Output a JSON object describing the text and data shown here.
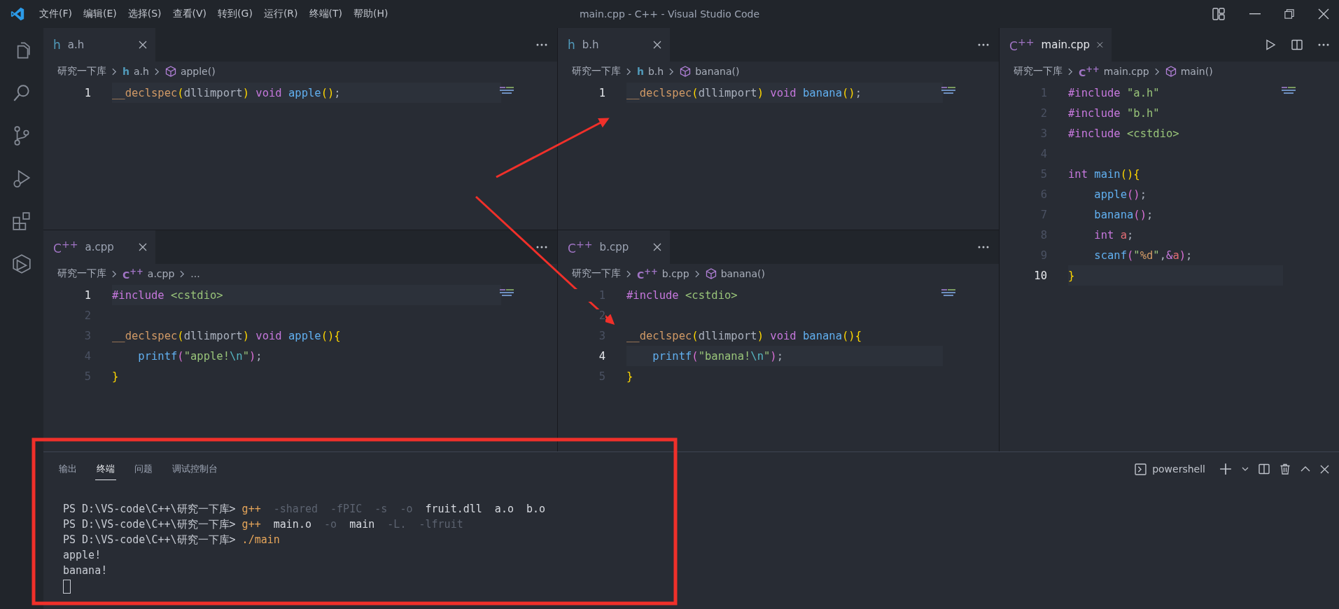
{
  "window": {
    "menus": [
      "文件(F)",
      "编辑(E)",
      "选择(S)",
      "查看(V)",
      "转到(G)",
      "运行(R)",
      "终端(T)",
      "帮助(H)"
    ],
    "title": "main.cpp - C++ - Visual Studio Code"
  },
  "editor_columns": [
    {
      "groups": [
        {
          "tab": {
            "label": "a.h",
            "icon": {
              "text": "h",
              "kind": "header"
            },
            "focused": false
          },
          "breadcrumbs": {
            "folder": "研究一下库",
            "file_icon": {
              "text": "h",
              "kind": "header"
            },
            "file": "a.h",
            "symbol": "apple()"
          },
          "lines": [
            {
              "number": "1",
              "current": true,
              "tokens": [
                {
                  "kind": "mac",
                  "text": "__declspec"
                },
                {
                  "kind": "b1",
                  "text": "("
                },
                {
                  "kind": "plain",
                  "text": "dllimport"
                },
                {
                  "kind": "b1",
                  "text": ")"
                },
                {
                  "kind": "kw",
                  "text": " void"
                },
                {
                  "kind": "fn",
                  "text": " apple"
                },
                {
                  "kind": "b1",
                  "text": "()"
                },
                {
                  "kind": "plain",
                  "text": ";"
                }
              ]
            }
          ]
        },
        {
          "tab": {
            "label": "a.cpp",
            "icon": {
              "text": "C$^{++}$",
              "kind": "cpp"
            },
            "focused": false
          },
          "breadcrumbs": {
            "folder": "研究一下库",
            "file_icon": {
              "text": "C$^{++}$",
              "kind": "cpp"
            },
            "file": "a.cpp",
            "more": "..."
          },
          "lines": [
            {
              "number": "1",
              "current": true,
              "tokens": [
                {
                  "kind": "kw",
                  "text": "#include"
                },
                {
                  "kind": "str",
                  "text": " <cstdio>"
                }
              ]
            },
            {
              "number": "2",
              "current": false
            },
            {
              "number": "3",
              "current": false,
              "tokens": [
                {
                  "kind": "mac",
                  "text": "__declspec"
                },
                {
                  "kind": "b1",
                  "text": "("
                },
                {
                  "kind": "plain",
                  "text": "dllimport"
                },
                {
                  "kind": "b1",
                  "text": ")"
                },
                {
                  "kind": "kw",
                  "text": " void"
                },
                {
                  "kind": "fn",
                  "text": " apple"
                },
                {
                  "kind": "b1",
                  "text": "(){"
                }
              ]
            },
            {
              "number": "4",
              "current": false,
              "indented": true,
              "tokens": [
                {
                  "kind": "fn",
                  "text": "printf"
                },
                {
                  "kind": "b2",
                  "text": "("
                },
                {
                  "kind": "str",
                  "text": "\"apple!"
                },
                {
                  "kind": "esc",
                  "text": "\\n"
                },
                {
                  "kind": "str",
                  "text": "\""
                },
                {
                  "kind": "b2",
                  "text": ")"
                },
                {
                  "kind": "plain",
                  "text": ";"
                }
              ]
            },
            {
              "number": "5",
              "current": false,
              "tokens": [
                {
                  "kind": "b1",
                  "text": "}"
                }
              ]
            }
          ]
        }
      ]
    },
    {
      "groups": [
        {
          "tab": {
            "label": "b.h",
            "icon": {
              "text": "h",
              "kind": "header"
            },
            "focused": false
          },
          "breadcrumbs": {
            "folder": "研究一下库",
            "file_icon": {
              "text": "h",
              "kind": "header"
            },
            "file": "b.h",
            "symbol": "banana()"
          },
          "lines": [
            {
              "number": "1",
              "current": true,
              "tokens": [
                {
                  "kind": "mac",
                  "text": "__declspec"
                },
                {
                  "kind": "b1",
                  "text": "("
                },
                {
                  "kind": "plain",
                  "text": "dllimport"
                },
                {
                  "kind": "b1",
                  "text": ")"
                },
                {
                  "kind": "kw",
                  "text": " void"
                },
                {
                  "kind": "fn",
                  "text": " banana"
                },
                {
                  "kind": "b1",
                  "text": "()"
                },
                {
                  "kind": "plain",
                  "text": ";"
                }
              ]
            }
          ]
        },
        {
          "tab": {
            "label": "b.cpp",
            "icon": {
              "text": "C$^{++}$",
              "kind": "cpp"
            },
            "focused": false
          },
          "breadcrumbs": {
            "folder": "研究一下库",
            "file_icon": {
              "text": "C$^{++}$",
              "kind": "cpp"
            },
            "file": "b.cpp",
            "symbol": "banana()"
          },
          "lines": [
            {
              "number": "1",
              "current": false,
              "tokens": [
                {
                  "kind": "kw",
                  "text": "#include"
                },
                {
                  "kind": "str",
                  "text": " <cstdio>"
                }
              ]
            },
            {
              "number": "2",
              "current": false
            },
            {
              "number": "3",
              "current": false,
              "tokens": [
                {
                  "kind": "mac",
                  "text": "__declspec"
                },
                {
                  "kind": "b1",
                  "text": "("
                },
                {
                  "kind": "plain",
                  "text": "dllimport"
                },
                {
                  "kind": "b1",
                  "text": ")"
                },
                {
                  "kind": "kw",
                  "text": " void"
                },
                {
                  "kind": "fn",
                  "text": " banana"
                },
                {
                  "kind": "b1",
                  "text": "(){"
                }
              ]
            },
            {
              "number": "4",
              "current": true,
              "indented": true,
              "tokens": [
                {
                  "kind": "fn",
                  "text": "printf"
                },
                {
                  "kind": "b2",
                  "text": "("
                },
                {
                  "kind": "str",
                  "text": "\"banana!"
                },
                {
                  "kind": "esc",
                  "text": "\\n"
                },
                {
                  "kind": "str",
                  "text": "\""
                },
                {
                  "kind": "b2",
                  "text": ")"
                },
                {
                  "kind": "plain",
                  "text": ";"
                }
              ]
            },
            {
              "number": "5",
              "current": false,
              "tokens": [
                {
                  "kind": "b1",
                  "text": "}"
                }
              ]
            }
          ]
        }
      ]
    },
    {
      "groups": [
        {
          "tab": {
            "label": "main.cpp",
            "icon": {
              "text": "C$^{++}$",
              "kind": "cpp"
            },
            "focused": true
          },
          "breadcrumbs": {
            "folder": "研究一下库",
            "file_icon": {
              "text": "C$^{++}$",
              "kind": "cpp"
            },
            "file": "main.cpp",
            "symbol": "main()"
          },
          "lines": [
            {
              "number": "1",
              "current": false,
              "tokens": [
                {
                  "kind": "kw",
                  "text": "#include"
                },
                {
                  "kind": "str",
                  "text": " \"a.h\""
                }
              ]
            },
            {
              "number": "2",
              "current": false,
              "tokens": [
                {
                  "kind": "kw",
                  "text": "#include"
                },
                {
                  "kind": "str",
                  "text": " \"b.h\""
                }
              ]
            },
            {
              "number": "3",
              "current": false,
              "tokens": [
                {
                  "kind": "kw",
                  "text": "#include"
                },
                {
                  "kind": "str",
                  "text": " <cstdio>"
                }
              ]
            },
            {
              "number": "4",
              "current": false
            },
            {
              "number": "5",
              "current": false,
              "tokens": [
                {
                  "kind": "kw",
                  "text": "int"
                },
                {
                  "kind": "fn",
                  "text": " main"
                },
                {
                  "kind": "b1",
                  "text": "(){"
                }
              ]
            },
            {
              "number": "6",
              "current": false,
              "indented": true,
              "tokens": [
                {
                  "kind": "fn",
                  "text": "apple"
                },
                {
                  "kind": "b2",
                  "text": "()"
                },
                {
                  "kind": "plain",
                  "text": ";"
                }
              ]
            },
            {
              "number": "7",
              "current": false,
              "indented": true,
              "tokens": [
                {
                  "kind": "fn",
                  "text": "banana"
                },
                {
                  "kind": "b2",
                  "text": "()"
                },
                {
                  "kind": "plain",
                  "text": ";"
                }
              ]
            },
            {
              "number": "8",
              "current": false,
              "indented": true,
              "tokens": [
                {
                  "kind": "kw",
                  "text": "int"
                },
                {
                  "kind": "var",
                  "text": " a"
                },
                {
                  "kind": "plain",
                  "text": ";"
                }
              ]
            },
            {
              "number": "9",
              "current": false,
              "indented": true,
              "tokens": [
                {
                  "kind": "fn",
                  "text": "scanf"
                },
                {
                  "kind": "b2",
                  "text": "("
                },
                {
                  "kind": "str",
                  "text": "\""
                },
                {
                  "kind": "fmt",
                  "text": "%d"
                },
                {
                  "kind": "str",
                  "text": "\""
                },
                {
                  "kind": "plain",
                  "text": ","
                },
                {
                  "kind": "kw",
                  "text": "&"
                },
                {
                  "kind": "var",
                  "text": "a"
                },
                {
                  "kind": "b2",
                  "text": ")"
                },
                {
                  "kind": "plain",
                  "text": ";"
                }
              ]
            },
            {
              "number": "10",
              "current": true,
              "tokens": [
                {
                  "kind": "b1",
                  "text": "}"
                }
              ]
            }
          ]
        }
      ]
    }
  ],
  "panel": {
    "tabs": [
      {
        "label": "输出",
        "selected": false
      },
      {
        "label": "终端",
        "selected": true
      },
      {
        "label": "问题",
        "selected": false
      },
      {
        "label": "调试控制台",
        "selected": false
      }
    ],
    "shell": "powershell",
    "terminal_lines": [
      [
        {
          "kind": "prompt",
          "text": "PS D:\\VS-code\\C++\\研究一下库>"
        },
        {
          "kind": "cmd",
          "text": " g++"
        },
        {
          "kind": "flag",
          "text": "  -shared  -fPIC  -s  -o"
        },
        {
          "kind": "arg",
          "text": "  fruit.dll  a.o  b.o"
        }
      ],
      [
        {
          "kind": "prompt",
          "text": "PS D:\\VS-code\\C++\\研究一下库>"
        },
        {
          "kind": "cmd",
          "text": " g++"
        },
        {
          "kind": "arg",
          "text": "  main.o"
        },
        {
          "kind": "flag",
          "text": "  -o"
        },
        {
          "kind": "arg",
          "text": "  main"
        },
        {
          "kind": "flag",
          "text": "  -L.  -lfruit"
        }
      ],
      [
        {
          "kind": "prompt",
          "text": "PS D:\\VS-code\\C++\\研究一下库>"
        },
        {
          "kind": "cmd",
          "text": " ./main"
        }
      ],
      [
        {
          "kind": "out",
          "text": "apple!"
        }
      ],
      [
        {
          "kind": "out",
          "text": "banana!"
        }
      ]
    ]
  }
}
